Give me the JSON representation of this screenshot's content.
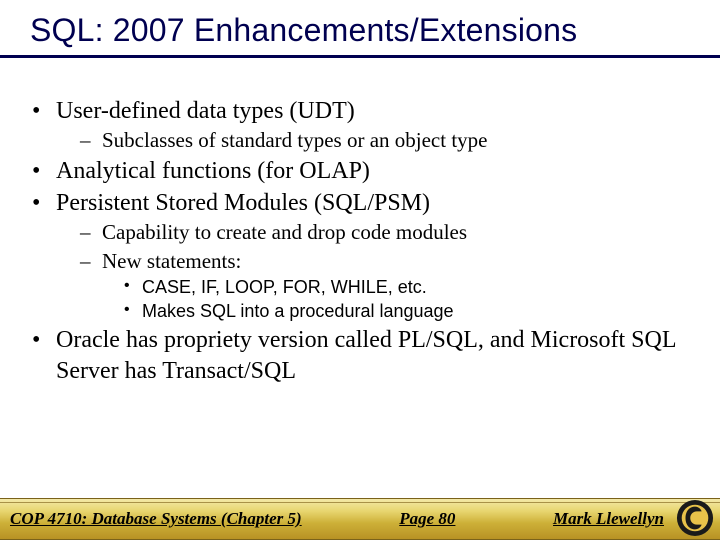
{
  "title": "SQL: 2007 Enhancements/Extensions",
  "bullets": {
    "b1": "User-defined data types (UDT)",
    "b1_1": "Subclasses of standard types or an object type",
    "b2": "Analytical functions (for OLAP)",
    "b3": "Persistent Stored Modules (SQL/PSM)",
    "b3_1": "Capability to create and drop code modules",
    "b3_2": "New statements:",
    "b3_2_1": "CASE, IF, LOOP, FOR, WHILE, etc.",
    "b3_2_2": "Makes SQL into a procedural language",
    "b4": "Oracle has propriety version called PL/SQL, and Microsoft SQL Server has Transact/SQL"
  },
  "footer": {
    "left": "COP 4710: Database Systems  (Chapter 5)",
    "center": "Page 80",
    "right": "Mark Llewellyn"
  }
}
